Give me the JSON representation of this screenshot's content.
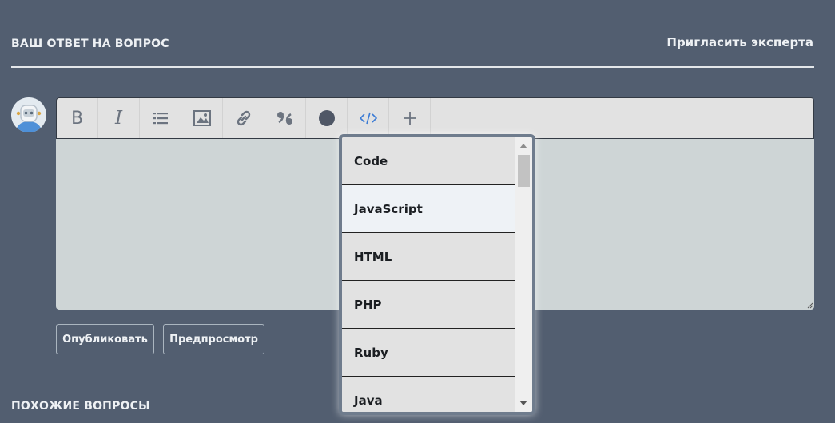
{
  "answer": {
    "title": "ВАШ ОТВЕТ НА ВОПРОС",
    "invite_label": "Пригласить эксперта"
  },
  "toolbar": {
    "icons": [
      "bold-icon",
      "italic-icon",
      "list-icon",
      "image-icon",
      "link-icon",
      "quote-icon",
      "spoiler-icon",
      "code-icon",
      "add-icon"
    ],
    "bold_label": "B",
    "italic_label": "I"
  },
  "editor": {
    "value": ""
  },
  "buttons": {
    "publish": "Опубликовать",
    "preview": "Предпросмотр"
  },
  "code_dropdown": {
    "items": [
      "Code",
      "JavaScript",
      "HTML",
      "PHP",
      "Ruby",
      "Java"
    ],
    "active": "JavaScript"
  },
  "similar": {
    "title": "ПОХОЖИЕ ВОПРОСЫ"
  },
  "colors": {
    "background": "#525e70",
    "toolbar": "#e2e2e2",
    "editor": "#ced5d6",
    "code_icon": "#3a7bd5"
  }
}
